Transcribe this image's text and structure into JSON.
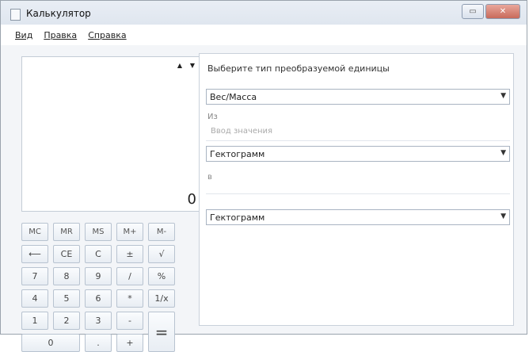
{
  "window": {
    "title": "Калькулятор",
    "caption_buttons": [
      "▭",
      "✕"
    ]
  },
  "menu": [
    "Вид",
    "Правка",
    "Справка"
  ],
  "display": {
    "value": "0",
    "history_up": "▲",
    "history_down": "▼"
  },
  "keys": {
    "row1": [
      "MC",
      "MR",
      "MS",
      "M+",
      "M-"
    ],
    "row2": [
      "⟵",
      "CE",
      "C",
      "±",
      "√"
    ],
    "row3": [
      "7",
      "8",
      "9",
      "/",
      "%"
    ],
    "row4": [
      "4",
      "5",
      "6",
      "*",
      "1/x"
    ],
    "row5": [
      "1",
      "2",
      "3",
      "-"
    ],
    "row6": [
      "0",
      ".",
      "+"
    ],
    "equals": "="
  },
  "converter": {
    "heading": "Выберите тип преобразуемой единицы",
    "type_select": "Вес/Масса",
    "from_label": "Из",
    "input_placeholder": "Ввод значения",
    "from_unit": "Гектограмм",
    "to_label": "в",
    "to_unit": "Гектограмм",
    "arrow": "▼"
  }
}
